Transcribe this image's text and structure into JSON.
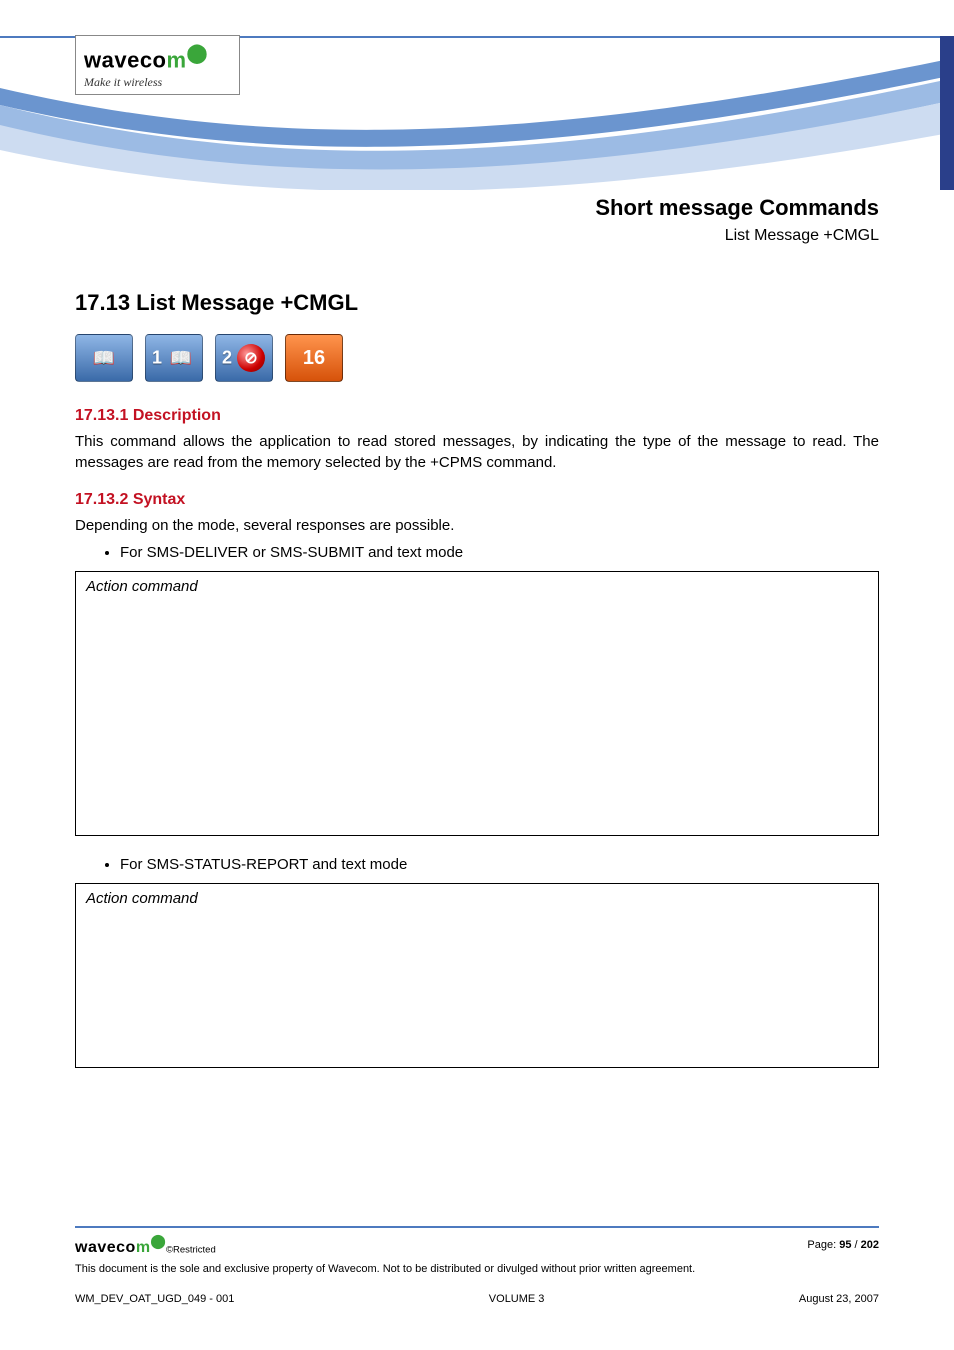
{
  "logo": {
    "brand_prefix": "waveco",
    "brand_suffix": "m",
    "tagline": "Make it wireless"
  },
  "header": {
    "title": "Short message Commands",
    "subtitle": "List Message +CMGL"
  },
  "s_main": {
    "num_title": "17.13   List Message +CMGL"
  },
  "icons": {
    "n1": "1",
    "n2": "2",
    "n16": "16",
    "book": "📖",
    "slash": "⊘"
  },
  "s_desc": {
    "heading": "17.13.1  Description",
    "body": "This command allows the application to read stored messages, by indicating the type of the message to read. The messages are read from the memory selected by the +CPMS command."
  },
  "s_syntax": {
    "heading": "17.13.2  Syntax",
    "intro": "Depending on the mode, several responses are possible.",
    "bullet1": "For SMS-DELIVER or SMS-SUBMIT and text mode",
    "bullet2": "For SMS-STATUS-REPORT and text mode",
    "box_label": "Action command"
  },
  "footer": {
    "brand_prefix": "waveco",
    "brand_suffix": "m",
    "restricted": "©Restricted",
    "page_label": "Page: ",
    "page_num": "95",
    "page_sep": " / ",
    "page_total": "202",
    "legal": "This document is the sole and exclusive property of Wavecom. Not to be distributed or divulged without prior written agreement.",
    "doc_id": "WM_DEV_OAT_UGD_049 - 001",
    "volume": "VOLUME 3",
    "date": "August 23, 2007"
  }
}
